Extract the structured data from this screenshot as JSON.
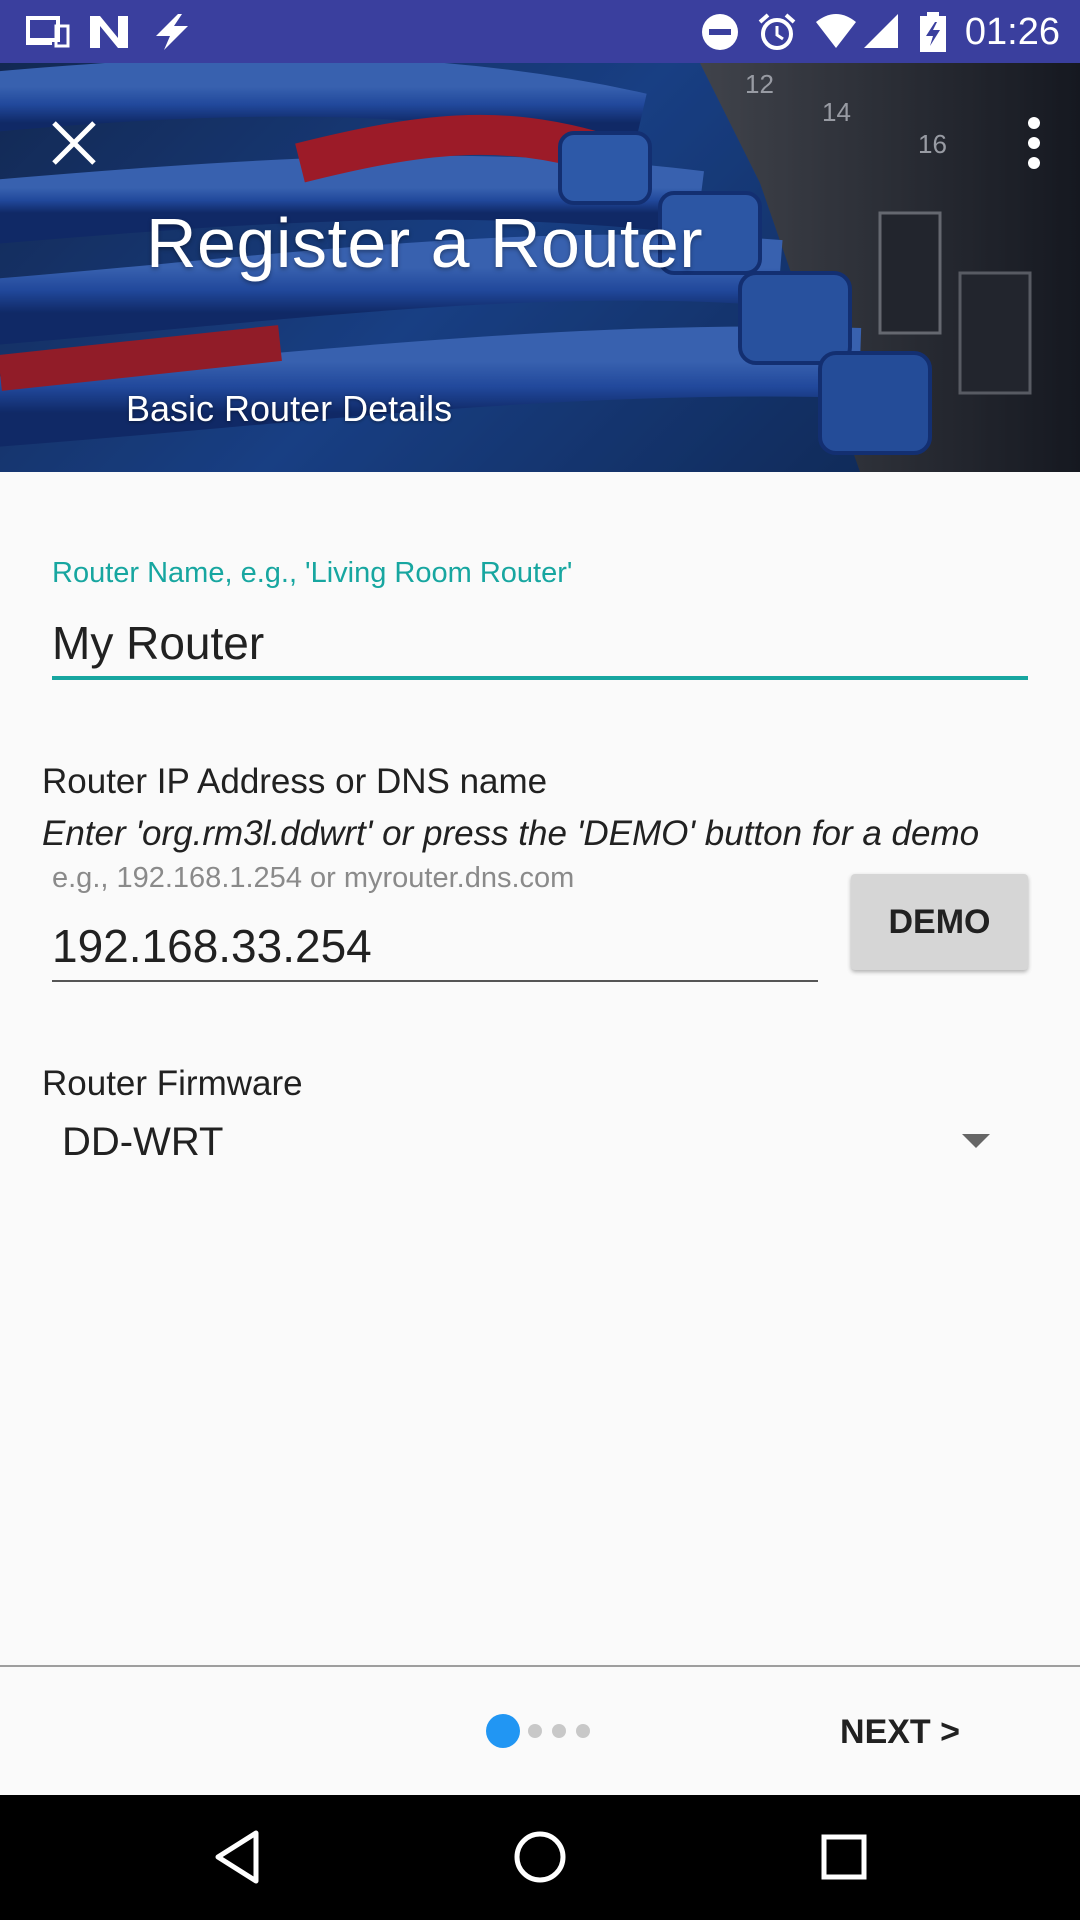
{
  "status_bar": {
    "time": "01:26",
    "left_icons": [
      "devices-icon",
      "n-logo-icon",
      "flash-icon"
    ],
    "right_icons": [
      "do-not-disturb-icon",
      "alarm-icon",
      "wifi-icon",
      "cell-signal-icon",
      "battery-charging-icon"
    ],
    "background": "#3a3f9e"
  },
  "header": {
    "title": "Register a Router",
    "subtitle": "Basic Router Details",
    "close_icon": "close-icon",
    "menu_icon": "more-vert-icon",
    "port_numbers": [
      "12",
      "14",
      "16"
    ]
  },
  "form": {
    "router_name": {
      "label": "Router Name, e.g., 'Living Room Router'",
      "value": "My Router"
    },
    "router_ip": {
      "label": "Router IP Address or DNS name",
      "hint": "Enter 'org.rm3l.ddwrt' or press the 'DEMO' button for a demo",
      "placeholder": "e.g., 192.168.1.254 or myrouter.dns.com",
      "value": "192.168.33.254",
      "demo_button": "DEMO"
    },
    "firmware": {
      "label": "Router Firmware",
      "selected": "DD-WRT"
    }
  },
  "footer": {
    "next_label": "NEXT >",
    "pager": {
      "total": 4,
      "current": 1
    },
    "accent_color": "#17a6a0",
    "active_dot_color": "#2196f3"
  },
  "nav_bar": {
    "icons": [
      "back-icon",
      "home-icon",
      "recents-icon"
    ]
  }
}
